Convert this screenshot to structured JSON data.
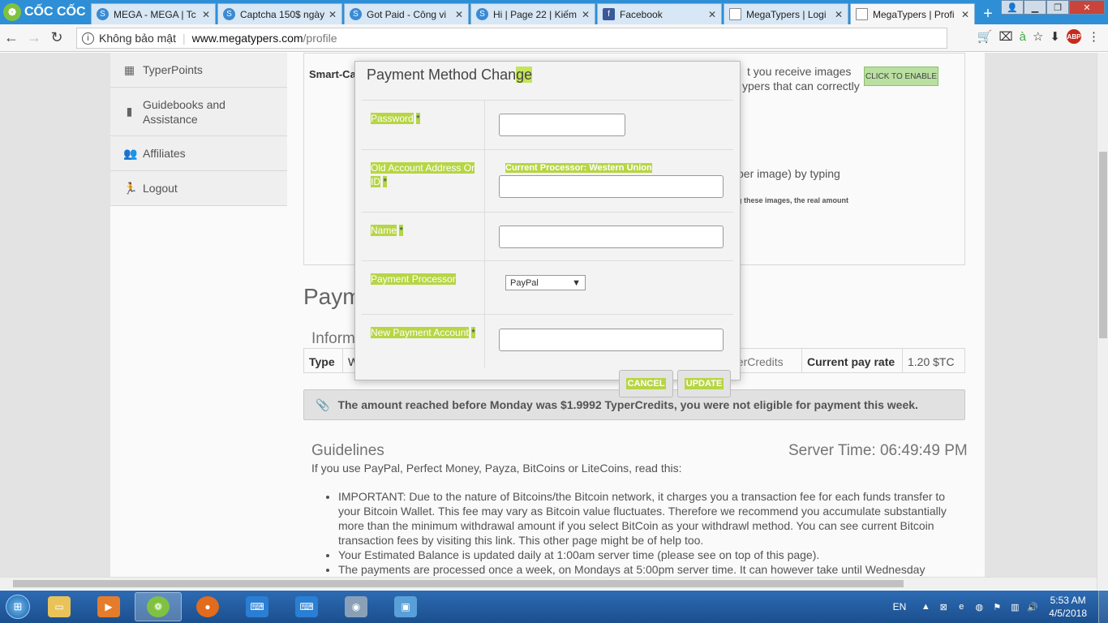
{
  "browser": {
    "logo_text": "CỐC CỐC",
    "tabs": [
      {
        "title": "MEGA - MEGA | Tc",
        "icon": "s-icon"
      },
      {
        "title": "Captcha 150$ ngày",
        "icon": "s-icon"
      },
      {
        "title": "Got Paid - Công vi",
        "icon": "s-icon"
      },
      {
        "title": "Hi | Page 22 | Kiếm",
        "icon": "s-icon"
      },
      {
        "title": "Facebook",
        "icon": "facebook-icon"
      },
      {
        "title": "MegaTypers | Logi",
        "icon": "doc-icon"
      },
      {
        "title": "MegaTypers | Profi",
        "icon": "doc-icon"
      }
    ],
    "close_glyph": "✕",
    "new_tab": "+",
    "security_label": "Không bảo mật",
    "url_host": "www.megatypers.com",
    "url_path": "/profile",
    "abp_label": "ABP"
  },
  "sidebar": {
    "items": [
      {
        "label": "TyperPoints",
        "icon": "▦"
      },
      {
        "label": "Guidebooks and Assistance",
        "icon": "▮"
      },
      {
        "label": "Affiliates",
        "icon": "👥"
      },
      {
        "label": "Logout",
        "icon": "🏃"
      }
    ]
  },
  "background": {
    "smart_label": "Smart-Cap",
    "text1": "t you receive images",
    "text2": "ypers that can correctly",
    "text3": "per image) by typing",
    "text4": "g these images, the real amount",
    "enable_button": "CLICK TO ENABLE",
    "payment_title": "Paym",
    "info_title": "Inform",
    "table": {
      "type_label": "Type",
      "type_value": "W",
      "credits_label": "perCredits",
      "rate_label": "Current pay rate",
      "rate_value": "1.20 $TC"
    },
    "notice": "The amount reached before Monday was $1.9992 TyperCredits, you were not eligible for payment this week.",
    "guidelines_title": "Guidelines",
    "server_time": "Server Time: 06:49:49 PM",
    "guidelines_intro": "If you use PayPal, Perfect Money, Payza, BitCoins or LiteCoins, read this:",
    "guidelines": [
      "IMPORTANT: Due to the nature of Bitcoins/the Bitcoin network, it charges you a transaction fee for each funds transfer to your Bitcoin Wallet. This fee may vary as Bitcoin value fluctuates. Therefore we recommend you accumulate substantially more than the minimum withdrawal amount if you select BitCoin as your withdrawl method. You can see current Bitcoin transaction fees by visiting this link. This other page might be of help too.",
      "Your Estimated Balance is updated daily at 1:00am server time (please see on top of this page).",
      "The payments are processed once a week, on Mondays at 5:00pm server time. It can however take until Wednesday morning"
    ]
  },
  "modal": {
    "title_main": "Payment Method Chan",
    "title_hl": "ge",
    "password_label": "Password",
    "old_account_label": "Old Account Address Or ID",
    "current_processor_prefix": "Current Processor:",
    "current_processor_value": "Western Union",
    "name_label": "Name",
    "processor_label": "Payment Processor",
    "processor_selected": "PayPal",
    "new_account_label": "New Payment Account",
    "required_mark": "*",
    "cancel_button": "CANCEL",
    "update_button": "UPDATE"
  },
  "taskbar": {
    "language": "EN",
    "time": "5:53 AM",
    "date": "4/5/2018"
  }
}
